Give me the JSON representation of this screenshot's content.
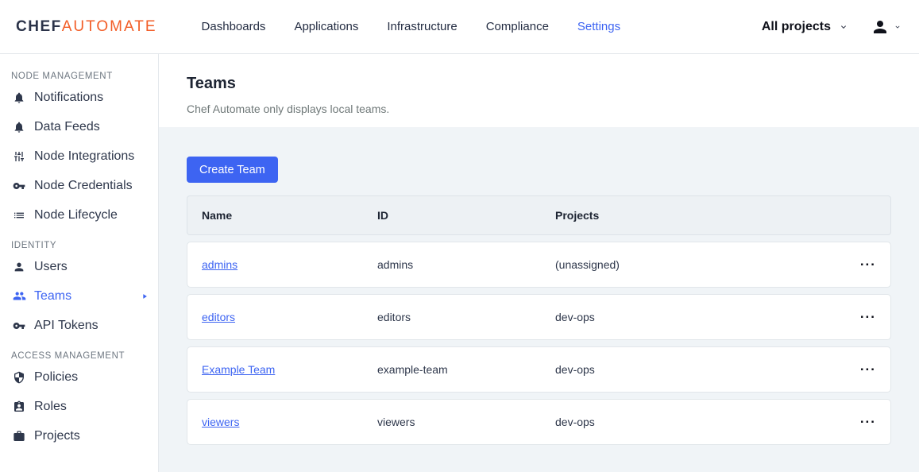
{
  "brand": {
    "chef": "CHEF",
    "automate": "AUTOMATE"
  },
  "colors": {
    "accent": "#3d64f2",
    "brand_orange": "#f25d27",
    "page_background": "#f0f4f7",
    "text_dark": "#1d2432",
    "text_muted": "#6f7878"
  },
  "nav": {
    "items": [
      {
        "label": "Dashboards",
        "active": false
      },
      {
        "label": "Applications",
        "active": false
      },
      {
        "label": "Infrastructure",
        "active": false
      },
      {
        "label": "Compliance",
        "active": false
      },
      {
        "label": "Settings",
        "active": true
      }
    ],
    "projects_filter": "All projects"
  },
  "sidebar": {
    "sections": [
      {
        "label": "NODE MANAGEMENT",
        "items": [
          {
            "label": "Notifications",
            "icon": "bell-icon"
          },
          {
            "label": "Data Feeds",
            "icon": "bell-icon"
          },
          {
            "label": "Node Integrations",
            "icon": "sliders-icon"
          },
          {
            "label": "Node Credentials",
            "icon": "key-icon"
          },
          {
            "label": "Node Lifecycle",
            "icon": "list-icon"
          }
        ]
      },
      {
        "label": "IDENTITY",
        "items": [
          {
            "label": "Users",
            "icon": "person-icon"
          },
          {
            "label": "Teams",
            "icon": "group-icon",
            "active": true
          },
          {
            "label": "API Tokens",
            "icon": "key-icon"
          }
        ]
      },
      {
        "label": "ACCESS MANAGEMENT",
        "items": [
          {
            "label": "Policies",
            "icon": "shield-icon"
          },
          {
            "label": "Roles",
            "icon": "badge-icon"
          },
          {
            "label": "Projects",
            "icon": "briefcase-icon"
          }
        ]
      }
    ]
  },
  "page": {
    "title": "Teams",
    "subtitle": "Chef Automate only displays local teams.",
    "create_button": "Create Team"
  },
  "table": {
    "columns": {
      "name": "Name",
      "id": "ID",
      "projects": "Projects"
    },
    "menu_label": "...",
    "rows": [
      {
        "name": "admins",
        "id": "admins",
        "projects": "(unassigned)"
      },
      {
        "name": "editors",
        "id": "editors",
        "projects": "dev-ops"
      },
      {
        "name": "Example Team",
        "id": "example-team",
        "projects": "dev-ops"
      },
      {
        "name": "viewers",
        "id": "viewers",
        "projects": "dev-ops"
      }
    ]
  }
}
